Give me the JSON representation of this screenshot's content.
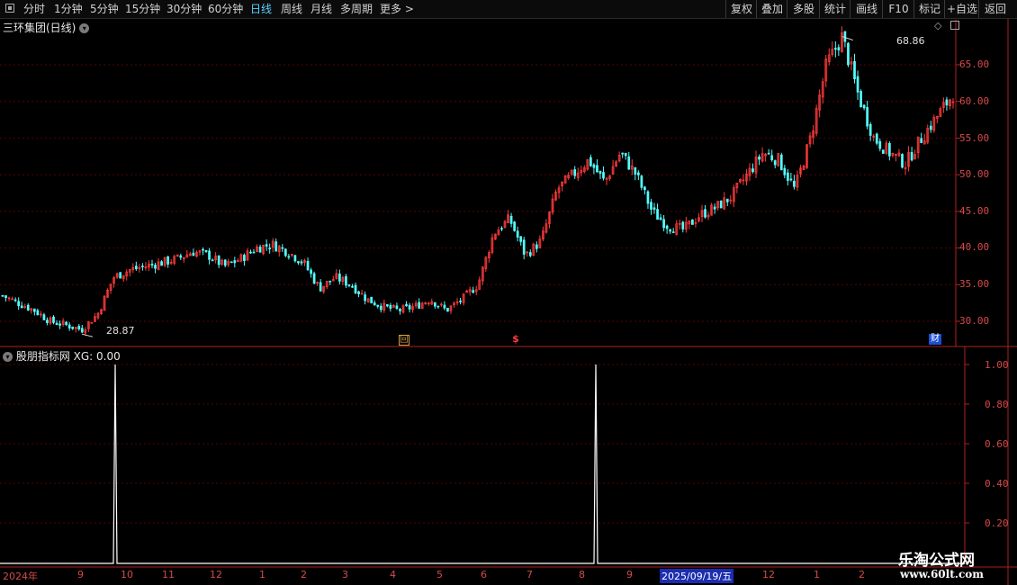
{
  "toolbar": {
    "periods": [
      "分时",
      "1分钟",
      "5分钟",
      "15分钟",
      "30分钟",
      "60分钟",
      "日线",
      "周线",
      "月线",
      "多周期",
      "更多 >"
    ],
    "active_period": "日线",
    "right_buttons": [
      "复权",
      "叠加",
      "多股",
      "统计",
      "画线",
      "F10",
      "标记",
      "+自选",
      "返回"
    ]
  },
  "main_panel": {
    "title": "三环集团(日线)",
    "high_label": "68.86",
    "low_label": "28.87",
    "y_ticks": [
      "65.00",
      "60.00",
      "55.00",
      "50.00",
      "45.00",
      "40.00",
      "35.00",
      "30.00"
    ],
    "markers": {
      "replay": "回",
      "dollar": "$",
      "finance": "财"
    }
  },
  "indicator_panel": {
    "title": "股朋指标网 XG: 0.00",
    "y_ticks": [
      "1.00",
      "0.80",
      "0.60",
      "0.40",
      "0.20"
    ]
  },
  "date_axis": {
    "labels": [
      "2024年",
      "9",
      "10",
      "11",
      "12",
      "1",
      "2",
      "3",
      "4",
      "5",
      "6",
      "7",
      "8",
      "9",
      "12",
      "1",
      "2"
    ],
    "cursor_label": "2025/09/19/五"
  },
  "watermark": {
    "line1": "乐淘公式网",
    "line2": "www.60lt.com"
  },
  "colors": {
    "up": "#ff3b3b",
    "down": "#54ffff",
    "grid": "#5a0000",
    "axis": "#b02020",
    "active": "#5ad1ff"
  },
  "chart_data": [
    {
      "type": "candlestick",
      "title": "三环集团(日线)",
      "y_range": [
        27,
        70
      ],
      "labelled_high": 68.86,
      "labelled_low": 28.87,
      "close_path_approx": [
        33.5,
        32.5,
        31.5,
        30,
        29.5,
        28.87,
        31,
        36,
        37,
        37.5,
        38,
        38.5,
        39.5,
        39,
        37.5,
        38.5,
        40,
        40.5,
        39.5,
        38,
        34.5,
        36,
        35,
        33,
        32,
        31.5,
        32,
        33,
        31.5,
        33,
        35,
        42,
        44,
        39,
        41,
        48,
        50,
        52,
        49,
        53,
        50,
        45,
        43,
        42.5,
        44.5,
        45.5,
        47,
        50,
        53,
        52,
        48,
        55,
        65,
        68.86,
        61,
        55,
        53,
        51.5,
        55,
        58,
        61
      ]
    },
    {
      "type": "line",
      "title": "股朋指标网 XG",
      "series": [
        {
          "name": "XG",
          "values": [
            0,
            1,
            0,
            1,
            0
          ]
        }
      ],
      "signal_dates_approx": [
        "2024-10",
        "2025-08"
      ],
      "y_range": [
        0,
        1
      ]
    }
  ]
}
